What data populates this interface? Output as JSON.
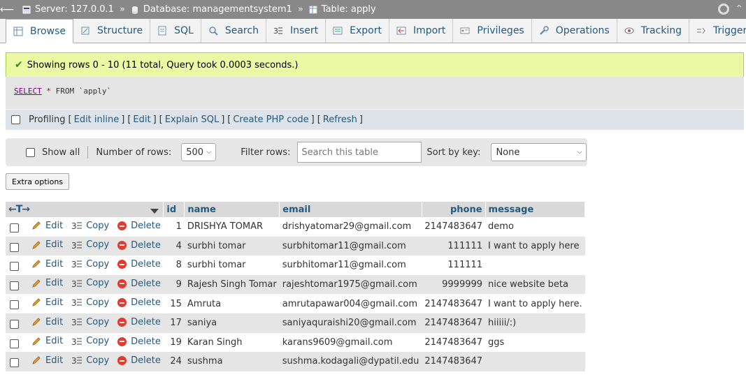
{
  "breadcrumb": {
    "server": "Server: 127.0.0.1",
    "database": "Database: managementsystem1",
    "table": "Table: apply",
    "separator": "»"
  },
  "tabs": [
    {
      "label": "Browse",
      "icon": "browse-icon"
    },
    {
      "label": "Structure",
      "icon": "structure-icon"
    },
    {
      "label": "SQL",
      "icon": "sql-icon"
    },
    {
      "label": "Search",
      "icon": "search-icon"
    },
    {
      "label": "Insert",
      "icon": "insert-icon"
    },
    {
      "label": "Export",
      "icon": "export-icon"
    },
    {
      "label": "Import",
      "icon": "import-icon"
    },
    {
      "label": "Privileges",
      "icon": "privileges-icon"
    },
    {
      "label": "Operations",
      "icon": "wrench-icon"
    },
    {
      "label": "Tracking",
      "icon": "eye-icon"
    },
    {
      "label": "Triggers",
      "icon": "triggers-icon"
    }
  ],
  "message": {
    "text": "Showing rows 0 - 10 (11 total, Query took 0.0003 seconds.)"
  },
  "sql": {
    "select": "SELECT",
    "star": "*",
    "from": "FROM",
    "table": "`apply`"
  },
  "profiling": {
    "label": "Profiling",
    "open": "[",
    "close": "]",
    "links": [
      "Edit inline",
      "Edit",
      "Explain SQL",
      "Create PHP code",
      "Refresh"
    ]
  },
  "nav": {
    "show_all": "Show all",
    "rows_label": "Number of rows:",
    "rows_value": "500",
    "filter_label": "Filter rows:",
    "filter_placeholder": "Search this table",
    "sort_label": "Sort by key:",
    "sort_value": "None"
  },
  "extra_options": "Extra options",
  "table": {
    "columns": [
      "id",
      "name",
      "email",
      "phone",
      "message"
    ],
    "action_labels": {
      "edit": "Edit",
      "copy": "Copy",
      "delete": "Delete"
    },
    "rows": [
      {
        "id": "1",
        "name": "DRISHYA TOMAR",
        "email": "drishyatomar29@gmail.com",
        "phone": "2147483647",
        "message": "demo"
      },
      {
        "id": "4",
        "name": "surbhi tomar",
        "email": "surbhitomar11@gmail.com",
        "phone": "111111",
        "message": "I want to apply here"
      },
      {
        "id": "8",
        "name": "surbhi tomar",
        "email": "surbhitomar11@gmail.com",
        "phone": "111111",
        "message": ""
      },
      {
        "id": "9",
        "name": "Rajesh Singh Tomar",
        "email": "rajeshtomar1975@gmail.com",
        "phone": "9999999",
        "message": "nice website beta"
      },
      {
        "id": "15",
        "name": "Amruta",
        "email": "amrutapawar004@gmail.com",
        "phone": "2147483647",
        "message": "I want to apply here."
      },
      {
        "id": "17",
        "name": "saniya",
        "email": "saniyaquraishi20@gmail.com",
        "phone": "2147483647",
        "message": "hiiiii/:)"
      },
      {
        "id": "19",
        "name": "Karan Singh",
        "email": "karans9609@gmail.com",
        "phone": "2147483647",
        "message": "ggs"
      },
      {
        "id": "24",
        "name": "sushma",
        "email": "sushma.kodagali@dypatil.edu",
        "phone": "2147483647",
        "message": ""
      }
    ]
  }
}
